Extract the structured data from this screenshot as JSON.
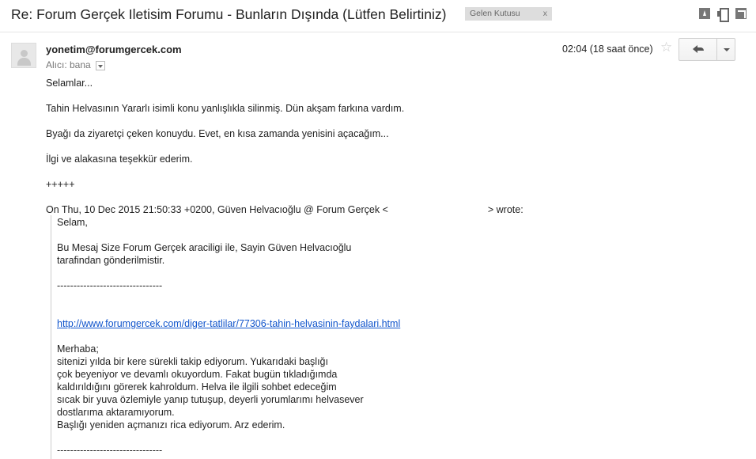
{
  "header": {
    "subject": "Re: Forum Gerçek Iletisim Forumu - Bunların Dışında (Lütfen Belirtiniz)",
    "label": "Gelen Kutusu",
    "label_close": "x"
  },
  "message": {
    "sender": "yonetim@forumgercek.com",
    "recipient_prefix": "Alıcı: bana",
    "time": "02:04 (18 saat önce)",
    "star_glyph": "☆",
    "body": [
      "Selamlar...",
      "Tahin Helvasının Yararlı isimli konu yanlışlıkla silinmiş. Dün akşam farkına vardım.",
      "Byağı da ziyaretçi çeken konuydu. Evet, en kısa zamanda yenisini açacağım...",
      "İlgi ve alakasına teşekkür ederim.",
      "+++++"
    ],
    "attribution_start": "On Thu, 10 Dec 2015 21:50:33 +0200, Güven Helvacıoğlu @ Forum Gerçek <",
    "attribution_end": "> wrote:",
    "quote": {
      "greeting": "Selam,",
      "line1": "Bu Mesaj Size Forum Gerçek araciligi ile, Sayin Güven Helvacıoğlu",
      "line2": "tarafindan gönderilmistir.",
      "separator": "--------------------------------",
      "link": "http://www.forumgercek.com/diger-tatlilar/77306-tahin-helvasinin-faydalari.html",
      "merhaba": "Merhaba;",
      "p1": "sitenizi yılda bir kere sürekli takip ediyorum. Yukarıdaki başlığı",
      "p2": "çok beyeniyor ve devamlı okuyordum. Fakat bugün tıkladığımda",
      "p3": "kaldırıldığını görerek kahroldum. Helva ile ilgili sohbet edeceğim",
      "p4": "sıcak bir yuva özlemiyle yanıp tutuşup, deyerli yorumlarımı helvasever",
      "p5": "dostlarıma aktaramıyorum.",
      "p6": "Başlığı yeniden açmanızı rica ediyorum. Arz ederim.",
      "separator2": "--------------------------------"
    }
  }
}
